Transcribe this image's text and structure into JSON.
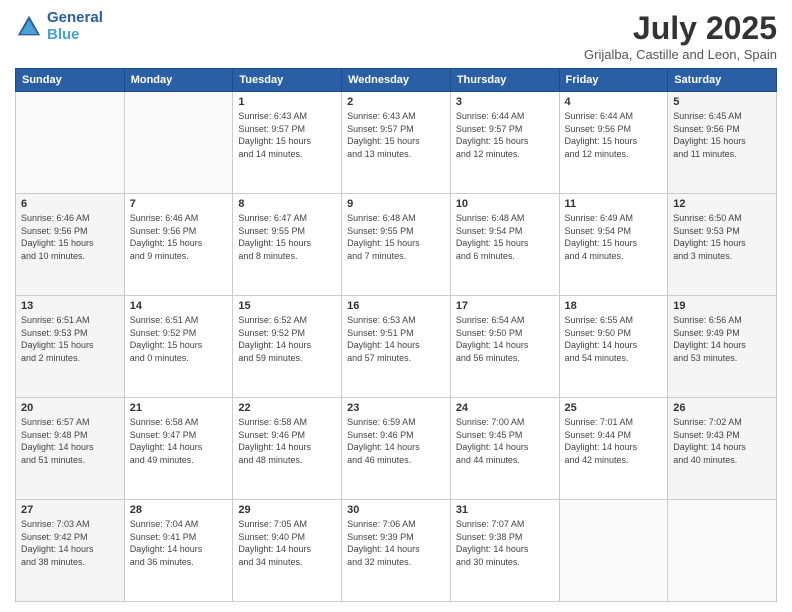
{
  "header": {
    "logo_line1": "General",
    "logo_line2": "Blue",
    "title": "July 2025",
    "subtitle": "Grijalba, Castille and Leon, Spain"
  },
  "calendar": {
    "days_of_week": [
      "Sunday",
      "Monday",
      "Tuesday",
      "Wednesday",
      "Thursday",
      "Friday",
      "Saturday"
    ],
    "weeks": [
      [
        {
          "day": "",
          "info": "",
          "empty": true,
          "weekend": false
        },
        {
          "day": "",
          "info": "",
          "empty": true,
          "weekend": false
        },
        {
          "day": "1",
          "info": "Sunrise: 6:43 AM\nSunset: 9:57 PM\nDaylight: 15 hours\nand 14 minutes.",
          "empty": false,
          "weekend": false
        },
        {
          "day": "2",
          "info": "Sunrise: 6:43 AM\nSunset: 9:57 PM\nDaylight: 15 hours\nand 13 minutes.",
          "empty": false,
          "weekend": false
        },
        {
          "day": "3",
          "info": "Sunrise: 6:44 AM\nSunset: 9:57 PM\nDaylight: 15 hours\nand 12 minutes.",
          "empty": false,
          "weekend": false
        },
        {
          "day": "4",
          "info": "Sunrise: 6:44 AM\nSunset: 9:56 PM\nDaylight: 15 hours\nand 12 minutes.",
          "empty": false,
          "weekend": false
        },
        {
          "day": "5",
          "info": "Sunrise: 6:45 AM\nSunset: 9:56 PM\nDaylight: 15 hours\nand 11 minutes.",
          "empty": false,
          "weekend": true
        }
      ],
      [
        {
          "day": "6",
          "info": "Sunrise: 6:46 AM\nSunset: 9:56 PM\nDaylight: 15 hours\nand 10 minutes.",
          "empty": false,
          "weekend": true
        },
        {
          "day": "7",
          "info": "Sunrise: 6:46 AM\nSunset: 9:56 PM\nDaylight: 15 hours\nand 9 minutes.",
          "empty": false,
          "weekend": false
        },
        {
          "day": "8",
          "info": "Sunrise: 6:47 AM\nSunset: 9:55 PM\nDaylight: 15 hours\nand 8 minutes.",
          "empty": false,
          "weekend": false
        },
        {
          "day": "9",
          "info": "Sunrise: 6:48 AM\nSunset: 9:55 PM\nDaylight: 15 hours\nand 7 minutes.",
          "empty": false,
          "weekend": false
        },
        {
          "day": "10",
          "info": "Sunrise: 6:48 AM\nSunset: 9:54 PM\nDaylight: 15 hours\nand 6 minutes.",
          "empty": false,
          "weekend": false
        },
        {
          "day": "11",
          "info": "Sunrise: 6:49 AM\nSunset: 9:54 PM\nDaylight: 15 hours\nand 4 minutes.",
          "empty": false,
          "weekend": false
        },
        {
          "day": "12",
          "info": "Sunrise: 6:50 AM\nSunset: 9:53 PM\nDaylight: 15 hours\nand 3 minutes.",
          "empty": false,
          "weekend": true
        }
      ],
      [
        {
          "day": "13",
          "info": "Sunrise: 6:51 AM\nSunset: 9:53 PM\nDaylight: 15 hours\nand 2 minutes.",
          "empty": false,
          "weekend": true
        },
        {
          "day": "14",
          "info": "Sunrise: 6:51 AM\nSunset: 9:52 PM\nDaylight: 15 hours\nand 0 minutes.",
          "empty": false,
          "weekend": false
        },
        {
          "day": "15",
          "info": "Sunrise: 6:52 AM\nSunset: 9:52 PM\nDaylight: 14 hours\nand 59 minutes.",
          "empty": false,
          "weekend": false
        },
        {
          "day": "16",
          "info": "Sunrise: 6:53 AM\nSunset: 9:51 PM\nDaylight: 14 hours\nand 57 minutes.",
          "empty": false,
          "weekend": false
        },
        {
          "day": "17",
          "info": "Sunrise: 6:54 AM\nSunset: 9:50 PM\nDaylight: 14 hours\nand 56 minutes.",
          "empty": false,
          "weekend": false
        },
        {
          "day": "18",
          "info": "Sunrise: 6:55 AM\nSunset: 9:50 PM\nDaylight: 14 hours\nand 54 minutes.",
          "empty": false,
          "weekend": false
        },
        {
          "day": "19",
          "info": "Sunrise: 6:56 AM\nSunset: 9:49 PM\nDaylight: 14 hours\nand 53 minutes.",
          "empty": false,
          "weekend": true
        }
      ],
      [
        {
          "day": "20",
          "info": "Sunrise: 6:57 AM\nSunset: 9:48 PM\nDaylight: 14 hours\nand 51 minutes.",
          "empty": false,
          "weekend": true
        },
        {
          "day": "21",
          "info": "Sunrise: 6:58 AM\nSunset: 9:47 PM\nDaylight: 14 hours\nand 49 minutes.",
          "empty": false,
          "weekend": false
        },
        {
          "day": "22",
          "info": "Sunrise: 6:58 AM\nSunset: 9:46 PM\nDaylight: 14 hours\nand 48 minutes.",
          "empty": false,
          "weekend": false
        },
        {
          "day": "23",
          "info": "Sunrise: 6:59 AM\nSunset: 9:46 PM\nDaylight: 14 hours\nand 46 minutes.",
          "empty": false,
          "weekend": false
        },
        {
          "day": "24",
          "info": "Sunrise: 7:00 AM\nSunset: 9:45 PM\nDaylight: 14 hours\nand 44 minutes.",
          "empty": false,
          "weekend": false
        },
        {
          "day": "25",
          "info": "Sunrise: 7:01 AM\nSunset: 9:44 PM\nDaylight: 14 hours\nand 42 minutes.",
          "empty": false,
          "weekend": false
        },
        {
          "day": "26",
          "info": "Sunrise: 7:02 AM\nSunset: 9:43 PM\nDaylight: 14 hours\nand 40 minutes.",
          "empty": false,
          "weekend": true
        }
      ],
      [
        {
          "day": "27",
          "info": "Sunrise: 7:03 AM\nSunset: 9:42 PM\nDaylight: 14 hours\nand 38 minutes.",
          "empty": false,
          "weekend": true
        },
        {
          "day": "28",
          "info": "Sunrise: 7:04 AM\nSunset: 9:41 PM\nDaylight: 14 hours\nand 36 minutes.",
          "empty": false,
          "weekend": false
        },
        {
          "day": "29",
          "info": "Sunrise: 7:05 AM\nSunset: 9:40 PM\nDaylight: 14 hours\nand 34 minutes.",
          "empty": false,
          "weekend": false
        },
        {
          "day": "30",
          "info": "Sunrise: 7:06 AM\nSunset: 9:39 PM\nDaylight: 14 hours\nand 32 minutes.",
          "empty": false,
          "weekend": false
        },
        {
          "day": "31",
          "info": "Sunrise: 7:07 AM\nSunset: 9:38 PM\nDaylight: 14 hours\nand 30 minutes.",
          "empty": false,
          "weekend": false
        },
        {
          "day": "",
          "info": "",
          "empty": true,
          "weekend": false
        },
        {
          "day": "",
          "info": "",
          "empty": true,
          "weekend": true
        }
      ]
    ]
  }
}
